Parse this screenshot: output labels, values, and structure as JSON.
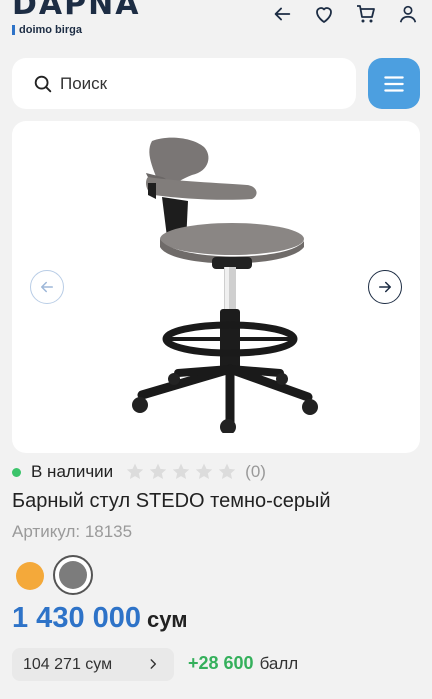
{
  "header": {
    "logo": "DAPNA",
    "sublogo": "doimo birga",
    "icons": [
      "arrow-left-icon",
      "heart-icon",
      "cart-icon",
      "user-icon"
    ]
  },
  "search": {
    "placeholder": "Поиск",
    "icon": "search-icon"
  },
  "menu": {
    "icon": "hamburger-icon",
    "color": "#4c9fe0"
  },
  "gallery": {
    "image": "chair-photo",
    "prev_icon": "arrow-left-circle-icon",
    "next_icon": "arrow-right-circle-icon"
  },
  "product": {
    "stock": "В наличии",
    "stock_color": "#3cc46b",
    "rating_stars": 0,
    "rating_max": 5,
    "reviews": "(0)",
    "title": "Барный стул STEDO темно-серый",
    "sku": "Артикул: 18135",
    "colors": [
      {
        "name": "orange",
        "hex": "#f4a93a",
        "selected": false
      },
      {
        "name": "grey",
        "hex": "#7c7c7c",
        "selected": true
      }
    ],
    "price": "1 430 000",
    "currency": "сум",
    "price_color": "#2e73c8",
    "installment": "104 271 сум",
    "bonus": "+28 600",
    "bonus_unit": "балл",
    "bonus_color": "#35b05c"
  }
}
